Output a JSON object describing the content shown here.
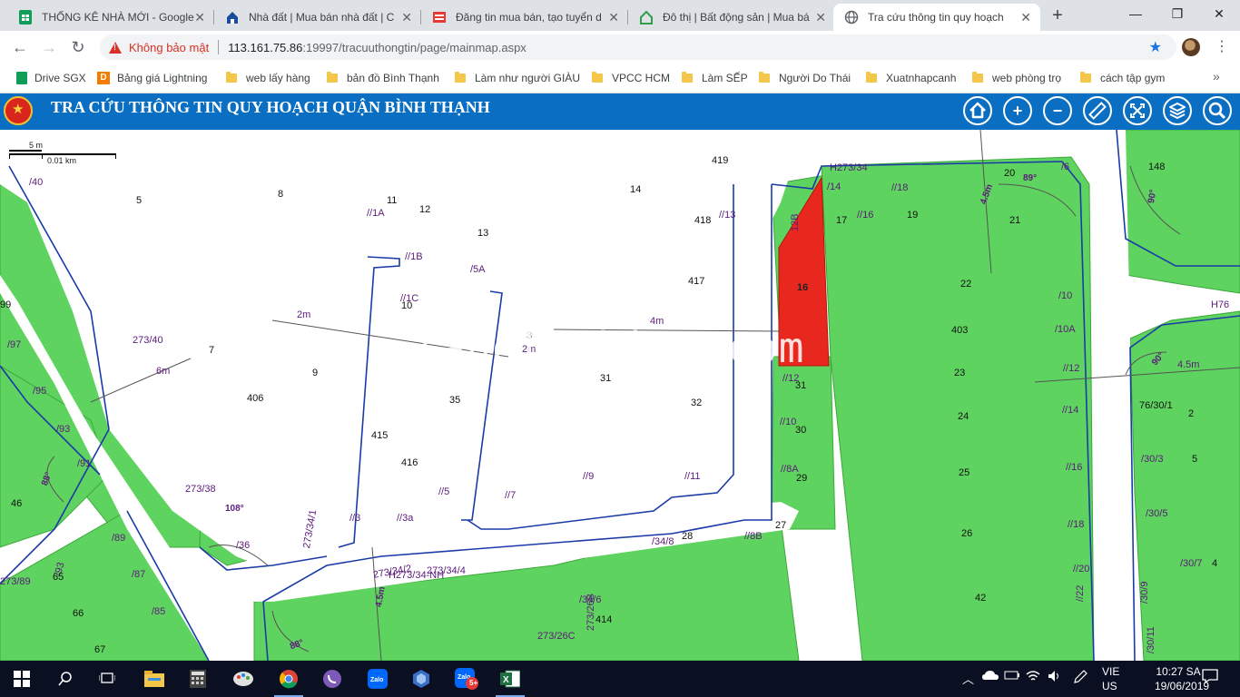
{
  "browser": {
    "tabs": [
      {
        "title": "THỐNG KÊ NHÀ MỚI - Google"
      },
      {
        "title": "Nhà đất | Mua bán nhà đất | C"
      },
      {
        "title": "Đăng tin mua bán, tạo tuyển d"
      },
      {
        "title": "Đô thị | Bất động sản | Mua bá"
      },
      {
        "title": "Tra cứu thông tin quy hoạch"
      }
    ],
    "new_tab": "+",
    "window": {
      "minimize": "—",
      "maximize": "❐",
      "close": "✕"
    },
    "nav": {
      "back": "←",
      "forward": "→",
      "reload": "↻"
    },
    "security_text": "Không bảo mật",
    "url_host": "113.161.75.86",
    "url_rest": ":19997/tracuuthongtin/page/mainmap.aspx",
    "bookmarks": [
      {
        "label": "Drive SGX",
        "icon": "sheets-icon"
      },
      {
        "label": "Bảng giá Lightning",
        "icon": "d-icon"
      },
      {
        "label": "web lấy hàng",
        "icon": "folder-icon"
      },
      {
        "label": "bản đồ Bình Thạnh",
        "icon": "folder-icon"
      },
      {
        "label": "Làm như người GIÀU",
        "icon": "folder-icon"
      },
      {
        "label": "VPCC HCM",
        "icon": "folder-icon"
      },
      {
        "label": "Làm SẾP",
        "icon": "folder-icon"
      },
      {
        "label": "Người Do Thái",
        "icon": "folder-icon"
      },
      {
        "label": "Xuatnhapcanh",
        "icon": "folder-icon"
      },
      {
        "label": "web phòng trọ",
        "icon": "folder-icon"
      },
      {
        "label": "cách tập gym",
        "icon": "folder-icon"
      }
    ],
    "bookmarks_more": "»"
  },
  "app": {
    "title": "TRA CỨU THÔNG TIN QUY HOẠCH QUẬN BÌNH THẠNH",
    "tools": [
      {
        "name": "home-button",
        "glyph": "⌂"
      },
      {
        "name": "zoom-in-button",
        "glyph": "+"
      },
      {
        "name": "zoom-out-button",
        "glyph": "−"
      },
      {
        "name": "measure-button",
        "glyph": "📏"
      },
      {
        "name": "fullscreen-button",
        "glyph": "⤢"
      },
      {
        "name": "layers-button",
        "glyph": "≋"
      },
      {
        "name": "search-button",
        "glyph": "🔍"
      }
    ],
    "colors": {
      "header": "#0a6fc2",
      "parcel": "#5fd35f",
      "highlight": "#e8281e",
      "boundary": "#1a3aa8"
    }
  },
  "map": {
    "scale": {
      "top": "5 m",
      "bottom": "0.01 km"
    },
    "watermark": "landlooking.com",
    "parcel_labels": [
      "419",
      "5",
      "8",
      "11",
      "12",
      "13",
      "14",
      "418",
      "//13",
      "17",
      "//16",
      "19",
      "//18",
      "20",
      "21",
      "148",
      "/40",
      "//1A",
      "//1B",
      "/5A",
      "417",
      "22",
      "//1C",
      "10",
      "3",
      "2m",
      "31",
      "4m",
      "403",
      "/10A",
      "2m",
      "32",
      "35",
      "406",
      "9",
      "7",
      "273/40",
      "6m",
      "//12",
      "31",
      "23",
      "//12",
      "4.5m",
      "76/30/1",
      "2",
      "/30/3",
      "5",
      "415",
      "416",
      "//5",
      "//7",
      "//9",
      "//11",
      "//10",
      "30",
      "24",
      "//14",
      "//8A",
      "29",
      "25",
      "//16",
      "/30/5",
      "273/38",
      "108°",
      "/36",
      "//3",
      "//3a",
      "/34/8",
      "28",
      "//8B",
      "27",
      "26",
      "//18",
      "/30/7",
      "4",
      "/89",
      "/87",
      "/85",
      "65",
      "66",
      "67",
      "46",
      "/91",
      "/93",
      "/95",
      "/97",
      "99",
      "//20",
      "/34/6",
      "414",
      "42",
      "//22",
      "/30/9",
      "273/26C",
      "273/26B",
      "/30/11",
      "/14",
      "/6",
      "/10",
      "H76",
      "H273/34",
      "90°",
      "89°",
      "90°",
      "88°",
      "88°",
      "16",
      "12B",
      "4.5m",
      "273/34/1",
      "273/34/2",
      "4.5m",
      "H273/34-NH",
      "273/34/4",
      "/93",
      "273/89"
    ],
    "chart_note": ""
  },
  "taskbar": {
    "apps": [
      "start-icon",
      "search-icon",
      "task-view-icon",
      "file-explorer-icon",
      "calculator-icon",
      "paint-icon",
      "chrome-icon",
      "viber-icon",
      "zalo-icon",
      "app-icon",
      "zalo-badge-icon",
      "excel-icon"
    ],
    "zalo_badge": "5+",
    "lang_top": "VIE",
    "lang_bottom": "US",
    "time": "10:27 SA",
    "date": "19/06/2019"
  }
}
